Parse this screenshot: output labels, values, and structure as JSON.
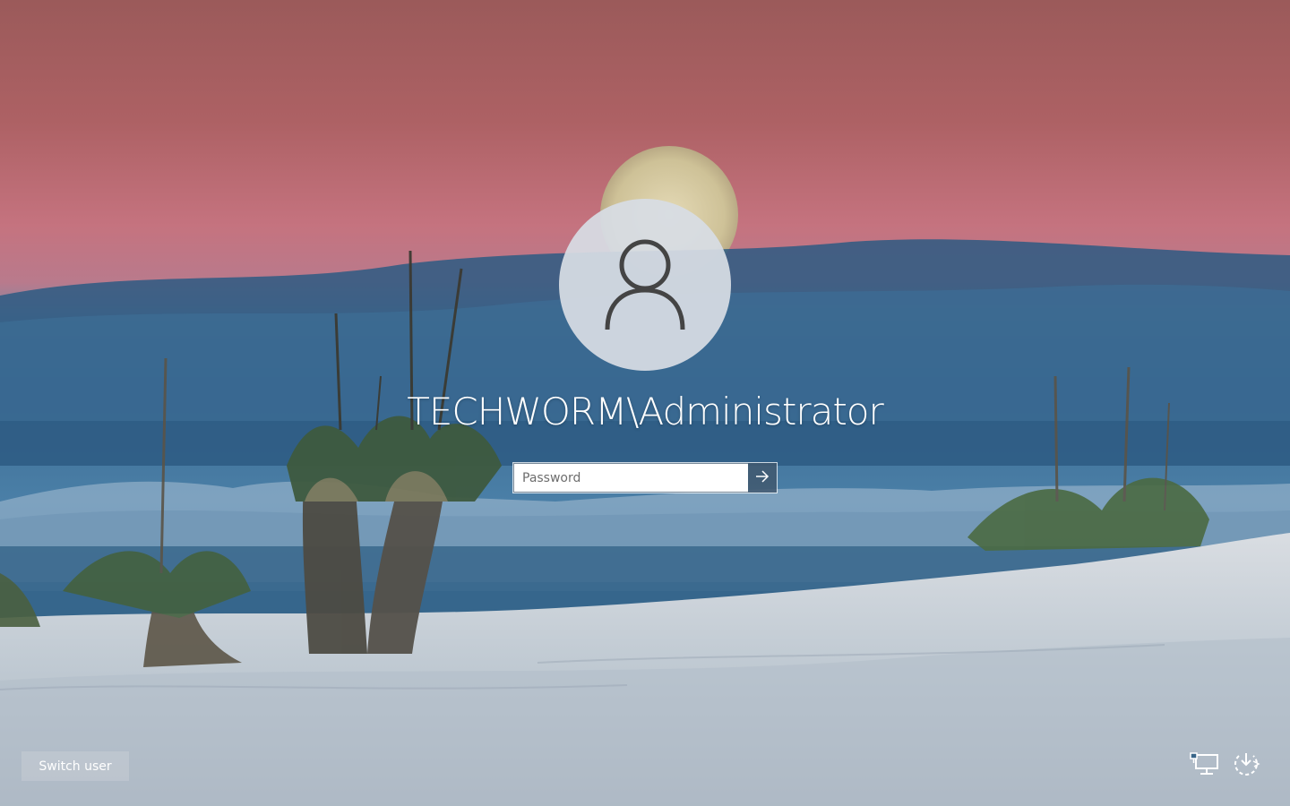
{
  "login": {
    "account_name": "TECHWORM\\Administrator",
    "password": {
      "placeholder": "Password",
      "value": ""
    },
    "submit_icon": "arrow-right-icon"
  },
  "avatar_icon": "user-icon",
  "footer": {
    "switch_user_label": "Switch user",
    "tray_icons": [
      "network-icon",
      "power-restart-icon"
    ]
  },
  "colors": {
    "sky_top": "#a35a5c",
    "sky_mid": "#c67780",
    "cloud_blue": "#2e5f86",
    "sand": "#cfd7de",
    "avatar_bg": "#d7dde4",
    "submit_bg": "#41586e"
  }
}
